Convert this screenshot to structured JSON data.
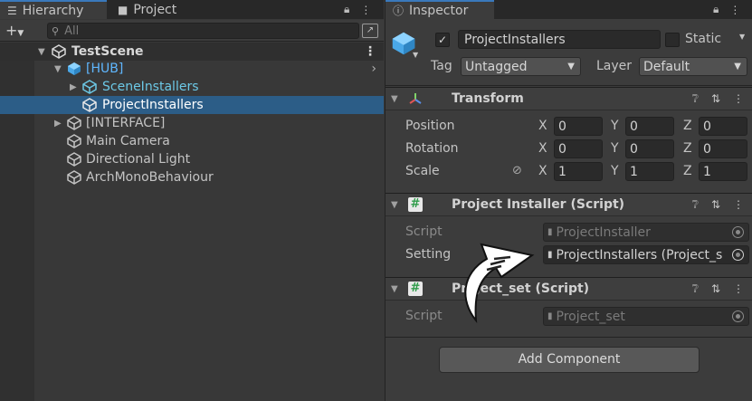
{
  "hierarchy": {
    "tabs": [
      {
        "label": "Hierarchy",
        "icon": "list-icon",
        "active": true
      },
      {
        "label": "Project",
        "icon": "folder-icon",
        "active": false
      }
    ],
    "search_placeholder": "All",
    "scene": {
      "label": "TestScene",
      "icon": "unity-scene-icon"
    },
    "items": [
      {
        "label": "[HUB]",
        "color": "#5fb7ff",
        "icon": "prefab-cube-icon",
        "expanded": true,
        "has_right_arrow": true
      },
      {
        "label": "SceneInstallers",
        "color": "#5fb7ff",
        "icon": "prefab-cube-icon",
        "expanded": false
      },
      {
        "label": "ProjectInstallers",
        "color": "#ffffff",
        "icon": "cube-icon",
        "selected": true
      },
      {
        "label": "[INTERFACE]",
        "color": "#c4c4c4",
        "icon": "cube-icon",
        "expanded": false
      },
      {
        "label": "Main Camera",
        "color": "#c4c4c4",
        "icon": "cube-icon"
      },
      {
        "label": "Directional Light",
        "color": "#c4c4c4",
        "icon": "cube-icon"
      },
      {
        "label": "ArchMonoBehaviour",
        "color": "#c4c4c4",
        "icon": "cube-icon"
      }
    ]
  },
  "inspector": {
    "tab": {
      "label": "Inspector",
      "icon": "info-icon"
    },
    "object": {
      "name": "ProjectInstallers",
      "active_checked": true,
      "static_label": "Static",
      "tag_label": "Tag",
      "tag_value": "Untagged",
      "layer_label": "Layer",
      "layer_value": "Default"
    },
    "transform": {
      "title": "Transform",
      "rows": [
        {
          "label": "Position",
          "x": "0",
          "y": "0",
          "z": "0"
        },
        {
          "label": "Rotation",
          "x": "0",
          "y": "0",
          "z": "0"
        },
        {
          "label": "Scale",
          "x": "1",
          "y": "1",
          "z": "1"
        }
      ],
      "axis": {
        "x": "X",
        "y": "Y",
        "z": "Z"
      }
    },
    "project_installer": {
      "title": "Project Installer (Script)",
      "script_label": "Script",
      "script_value": "ProjectInstaller",
      "setting_label": "Setting",
      "setting_value": "ProjectInstallers (Project_s"
    },
    "project_set": {
      "title": "Project_set (Script)",
      "script_label": "Script",
      "script_value": "Project_set"
    },
    "add_component_label": "Add Component"
  },
  "colors": {
    "selection": "#2c5d87",
    "prefab_text": "#5fb7ff",
    "accent_tab": "#3a79bb"
  }
}
